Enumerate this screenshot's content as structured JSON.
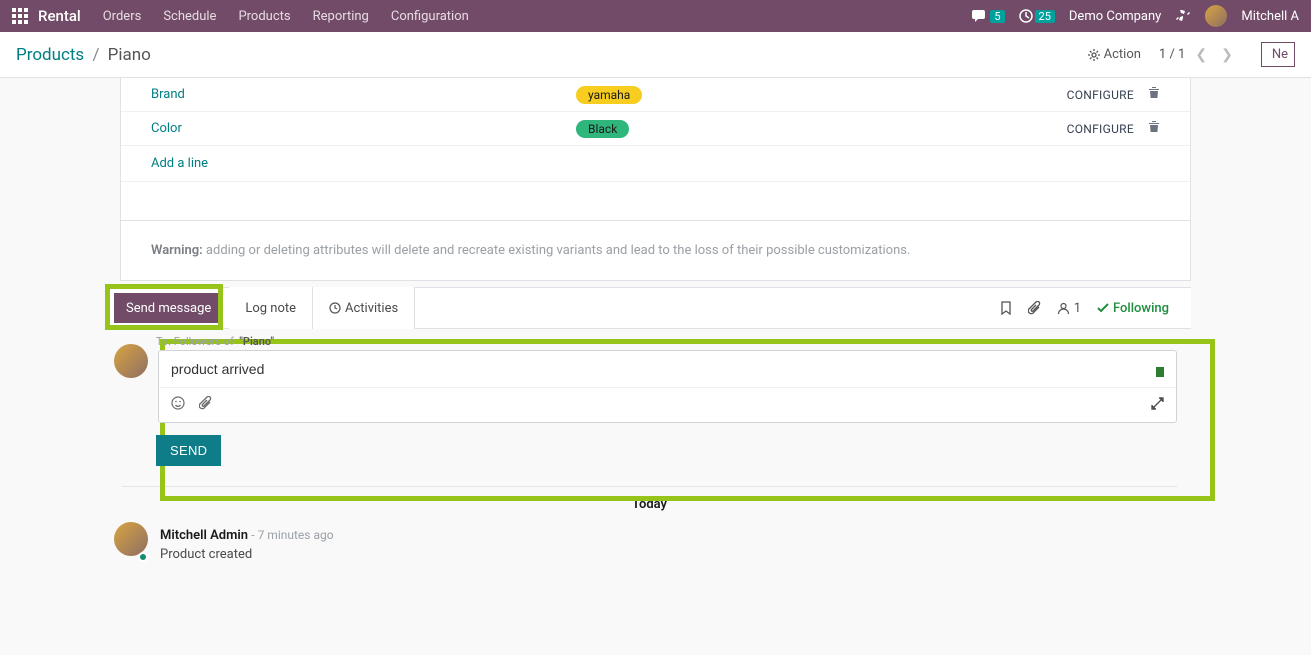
{
  "nav": {
    "brand": "Rental",
    "items": [
      "Orders",
      "Schedule",
      "Products",
      "Reporting",
      "Configuration"
    ],
    "chat_count": "5",
    "clock_count": "25",
    "company": "Demo Company",
    "user": "Mitchell A"
  },
  "breadcrumb": {
    "root": "Products",
    "current": "Piano"
  },
  "control": {
    "action": "Action",
    "pager": "1 / 1",
    "new_btn": "Ne"
  },
  "attributes": {
    "rows": [
      {
        "label": "Brand",
        "tag": "yamaha",
        "tag_color": "yellow",
        "action": "CONFIGURE"
      },
      {
        "label": "Color",
        "tag": "Black",
        "tag_color": "green",
        "action": "CONFIGURE"
      }
    ],
    "add_line": "Add a line",
    "warning_label": "Warning:",
    "warning_text": " adding or deleting attributes will delete and recreate existing variants and lead to the loss of their possible customizations."
  },
  "chatter": {
    "send_message": "Send message",
    "log_note": "Log note",
    "activities": "Activities",
    "followers_count": "1",
    "following": "Following",
    "to_prefix": "To: Followers of",
    "to_target": "\"Piano\"",
    "composer_text": "product arrived",
    "send_btn": "SEND",
    "today": "Today",
    "log": {
      "author": "Mitchell Admin",
      "when": "- 7 minutes ago",
      "body": "Product created"
    }
  }
}
